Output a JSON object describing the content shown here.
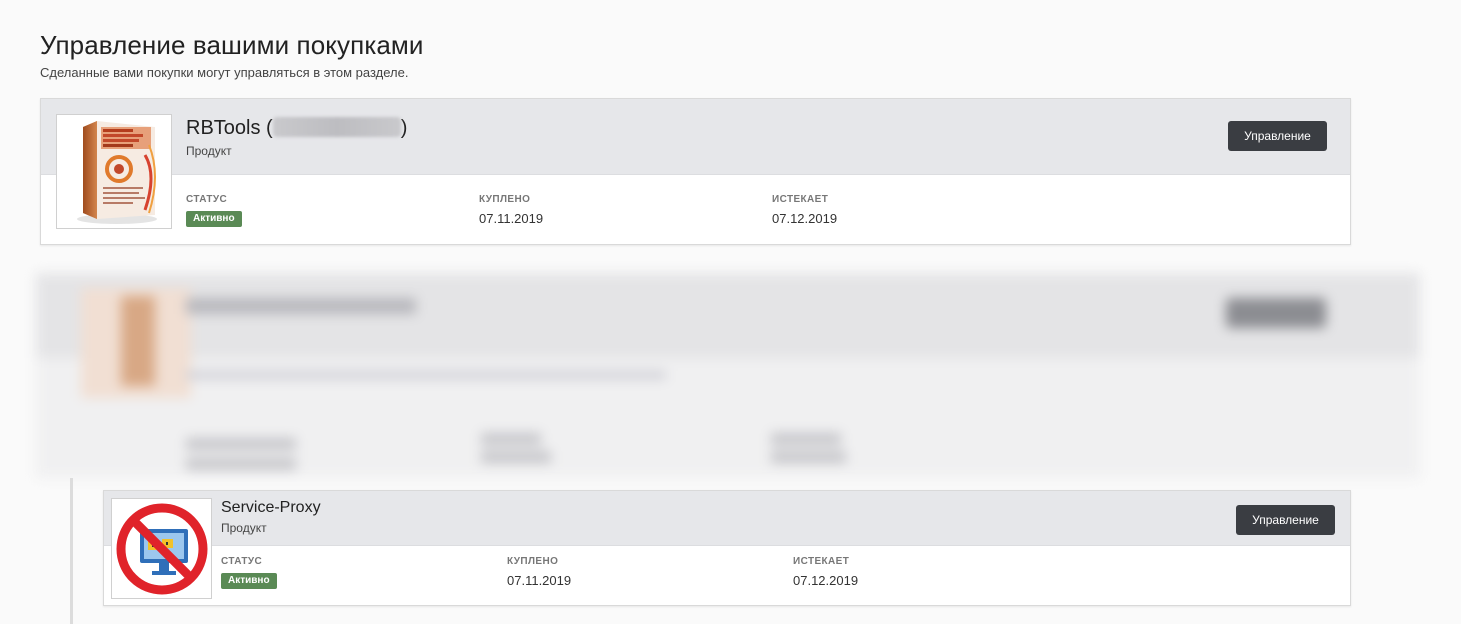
{
  "page": {
    "title": "Управление вашими покупками",
    "subtitle": "Сделанные вами покупки могут управляться в этом разделе."
  },
  "purchases": [
    {
      "name": "RBTools (",
      "name_suffix": ")",
      "name_redacted": true,
      "type": "Продукт",
      "manage_label": "Управление",
      "status_label": "СТАТУС",
      "status_value": "Активно",
      "bought_label": "КУПЛЕНО",
      "bought_value": "07.11.2019",
      "expires_label": "ИСТЕКАЕТ",
      "expires_value": "07.12.2019",
      "thumb_icon": "software-box-icon"
    },
    {
      "name": "Service-Proxy",
      "type": "Продукт",
      "manage_label": "Управление",
      "status_label": "СТАТУС",
      "status_value": "Активно",
      "bought_label": "КУПЛЕНО",
      "bought_value": "07.11.2019",
      "expires_label": "ИСТЕКАЕТ",
      "expires_value": "07.12.2019",
      "thumb_icon": "blocked-monitor-icon"
    }
  ],
  "colors": {
    "header_bg": "#e6e7ea",
    "button_bg": "#3a3d42",
    "badge_active": "#5a8a55"
  }
}
